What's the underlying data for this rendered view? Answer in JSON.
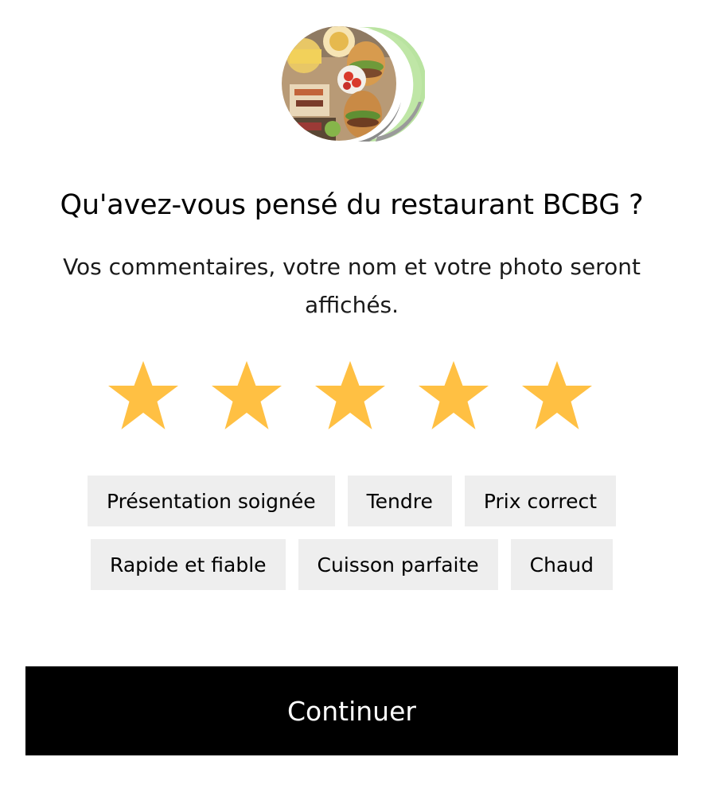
{
  "restaurant": {
    "avatar_icon": "restaurant-food-photo",
    "accent_arc_colors": [
      "#b9e3a0",
      "#8a8a8a"
    ]
  },
  "header": {
    "title": "Qu'avez-vous pensé du restaurant BCBG ?",
    "subtitle": "Vos commentaires, votre nom et votre photo seront affichés."
  },
  "rating": {
    "value": 5,
    "max": 5,
    "star_color": "#ffc043"
  },
  "tags": {
    "row1": [
      "Présentation soignée",
      "Tendre",
      "Prix correct"
    ],
    "row2": [
      "Rapide et fiable",
      "Cuisson parfaite",
      "Chaud"
    ]
  },
  "footer": {
    "continue_label": "Continuer"
  }
}
